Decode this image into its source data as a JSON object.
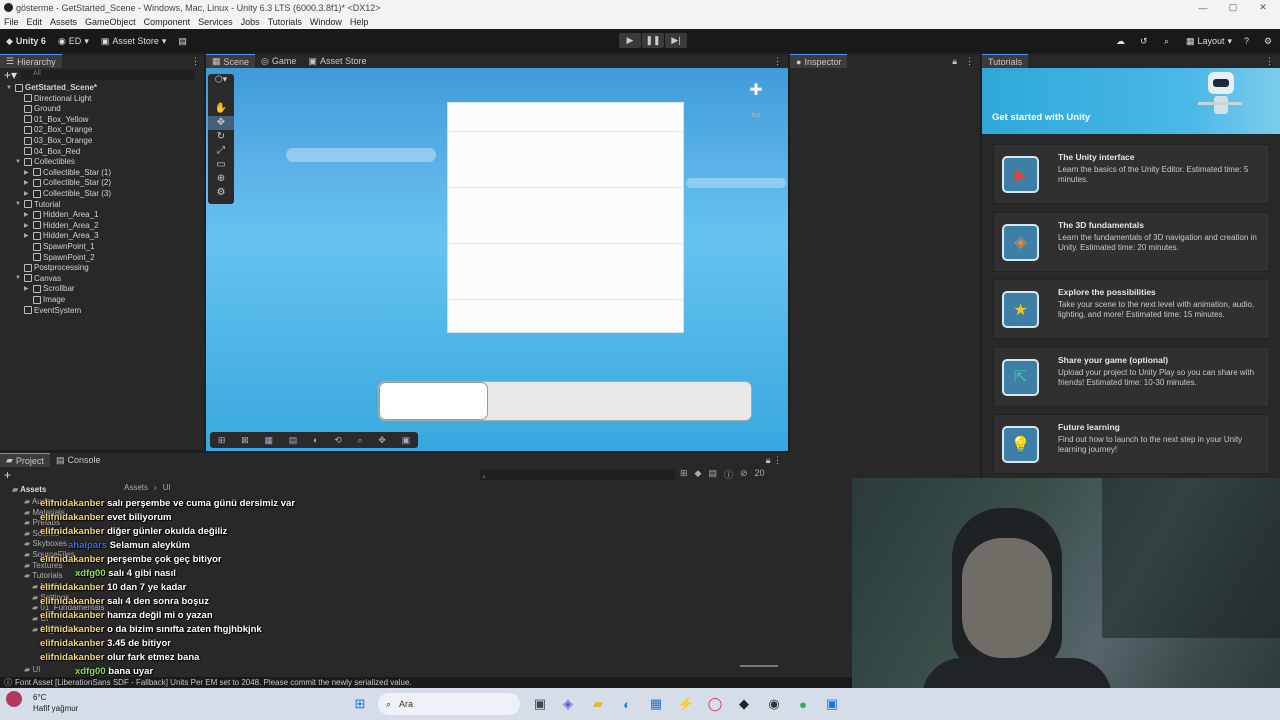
{
  "window": {
    "title": "gösterme - GetStarted_Scene - Windows, Mac, Linux - Unity 6.3 LTS (6000.3.8f1)* <DX12>"
  },
  "menu": [
    "File",
    "Edit",
    "Assets",
    "GameObject",
    "Component",
    "Services",
    "Jobs",
    "Tutorials",
    "Window",
    "Help"
  ],
  "toolbar": {
    "unity": "Unity 6",
    "account": "ED",
    "asset_store": "Asset Store",
    "layout": "Layout"
  },
  "scene_tabs": [
    "Scene",
    "Game",
    "Asset Store"
  ],
  "hierarchy": {
    "title": "Hierarchy",
    "search_placeholder": "All",
    "items": [
      {
        "label": "GetStarted_Scene*",
        "depth": 0,
        "expanded": true
      },
      {
        "label": "Directional Light",
        "depth": 1
      },
      {
        "label": "Ground",
        "depth": 1
      },
      {
        "label": "01_Box_Yellow",
        "depth": 1
      },
      {
        "label": "02_Box_Orange",
        "depth": 1
      },
      {
        "label": "03_Box_Orange",
        "depth": 1
      },
      {
        "label": "04_Box_Red",
        "depth": 1
      },
      {
        "label": "Collectibles",
        "depth": 1,
        "expanded": true
      },
      {
        "label": "Collectible_Star (1)",
        "depth": 2,
        "collapsed": true
      },
      {
        "label": "Collectible_Star (2)",
        "depth": 2,
        "collapsed": true
      },
      {
        "label": "Collectible_Star (3)",
        "depth": 2,
        "collapsed": true
      },
      {
        "label": "Tutorial",
        "depth": 1,
        "expanded": true
      },
      {
        "label": "Hidden_Area_1",
        "depth": 2,
        "collapsed": true
      },
      {
        "label": "Hidden_Area_2",
        "depth": 2,
        "collapsed": true
      },
      {
        "label": "Hidden_Area_3",
        "depth": 2,
        "collapsed": true
      },
      {
        "label": "SpawnPoint_1",
        "depth": 2
      },
      {
        "label": "SpawnPoint_2",
        "depth": 2
      },
      {
        "label": "Postprocessing",
        "depth": 1
      },
      {
        "label": "Canvas",
        "depth": 1,
        "expanded": true
      },
      {
        "label": "Scrollbar",
        "depth": 2,
        "collapsed": true
      },
      {
        "label": "Image",
        "depth": 2
      },
      {
        "label": "EventSystem",
        "depth": 1
      }
    ]
  },
  "scene_view": {
    "gizmo_label": "Iso"
  },
  "inspector": {
    "title": "Inspector"
  },
  "tutorials": {
    "title": "Tutorials",
    "banner": "Get started with Unity",
    "cards": [
      {
        "title": "The Unity interface",
        "desc": "Learn the basics of the Unity Editor. Estimated time: 5 minutes.",
        "icon": "play-icon"
      },
      {
        "title": "The 3D fundamentals",
        "desc": "Learn the fundamentals of 3D navigation and creation in Unity. Estimated time: 20 minutes.",
        "icon": "cube-icon"
      },
      {
        "title": "Explore the possibilities",
        "desc": "Take your scene to the next level with animation, audio, lighting, and more! Estimated time: 15 minutes.",
        "icon": "star-icon"
      },
      {
        "title": "Share your game (optional)",
        "desc": "Upload your project to Unity Play so you can share with friends! Estimated time: 10-30 minutes.",
        "icon": "share-icon"
      },
      {
        "title": "Future learning",
        "desc": "Find out how to launch to the next step in your Unity learning journey!",
        "icon": "lightbulb-icon"
      }
    ]
  },
  "project": {
    "tabs": [
      "Project",
      "Console"
    ],
    "breadcrumb": [
      "Assets",
      "UI"
    ],
    "count": "20",
    "folders": [
      "Assets",
      "Audio",
      "Materials",
      "Prefabs",
      "Scenes",
      "Skyboxes",
      "SourceFiles",
      "Textures",
      "Tutorials",
      "Media",
      "Settings",
      "01_Fundamentals",
      "UI",
      "02_Explore",
      "UI"
    ]
  },
  "chat": [
    {
      "user": "elifnidakanber",
      "msg": "salı perşembe ve cuma günü dersimiz var",
      "color": "#f5d76e"
    },
    {
      "user": "elifnidakanber",
      "msg": "evet biliyorum",
      "color": "#f5d76e"
    },
    {
      "user": "elifnidakanber",
      "msg": "diğer günler okulda değiliz",
      "color": "#f5d76e"
    },
    {
      "user": "ahalpars",
      "msg": "Selamun aleyküm",
      "color": "#3a6fd8"
    },
    {
      "user": "elifnidakanber",
      "msg": "perşembe çok geç bitiyor",
      "color": "#f5d76e"
    },
    {
      "user": "xdfg00",
      "msg": "salı 4 gibi nasıl",
      "color": "#8fe05a"
    },
    {
      "user": "elifnidakanber",
      "msg": "10 dan 7 ye kadar",
      "color": "#f5d76e"
    },
    {
      "user": "elifnidakanber",
      "msg": "salı 4 den sonra boşuz",
      "color": "#f5d76e"
    },
    {
      "user": "elifnidakanber",
      "msg": "hamza değil mi o yazan",
      "color": "#f5d76e"
    },
    {
      "user": "elifnidakanber",
      "msg": "o da bizim sınıfta zaten fhgjhbkjnk",
      "color": "#f5d76e"
    },
    {
      "user": "elifnidakanber",
      "msg": "3.45 de bitiyor",
      "color": "#f5d76e"
    },
    {
      "user": "elifnidakanber",
      "msg": "olur fark etmez bana",
      "color": "#f5d76e"
    },
    {
      "user": "xdfg00",
      "msg": "bana uyar",
      "color": "#8fe05a"
    }
  ],
  "status": "Font Asset [LiberationSans SDF - Fallback] Units Per EM set to 2048. Please commit the newly serialized value.",
  "taskbar": {
    "temp": "6°C",
    "weather": "Hafif yağmur",
    "search": "Ara"
  }
}
